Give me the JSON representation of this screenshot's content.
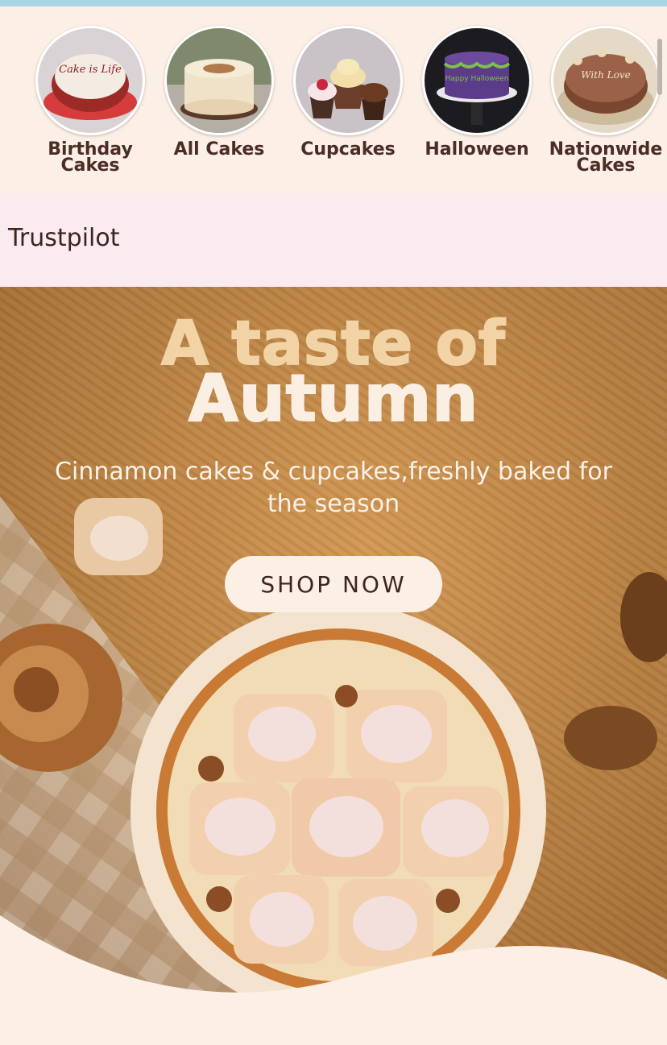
{
  "categories": [
    {
      "label": "Birthday\nCakes",
      "icon": "birthday-cake-image"
    },
    {
      "label": "All Cakes",
      "icon": "cake-image"
    },
    {
      "label": "Cupcakes",
      "icon": "cupcakes-image"
    },
    {
      "label": "Halloween",
      "icon": "halloween-cake-image"
    },
    {
      "label": "Nationwide\nCakes",
      "icon": "chocolate-cake-image"
    }
  ],
  "cake_texts": {
    "birthday": "Cake is Life",
    "halloween": "Happy Halloween",
    "nationwide": "With Love"
  },
  "trust": {
    "label": "Trustpilot"
  },
  "hero": {
    "title_line1": "A taste of",
    "title_line2": "Autumn",
    "subtitle": "Cinnamon cakes & cupcakes,freshly baked for the season",
    "button": "SHOP NOW"
  },
  "colors": {
    "page_bg": "#fcefe6",
    "top_bar": "#a9d4e6",
    "trust_bg": "#f9ebef",
    "title_accent": "#f2d3a6",
    "text_dark": "#4a2d24"
  }
}
